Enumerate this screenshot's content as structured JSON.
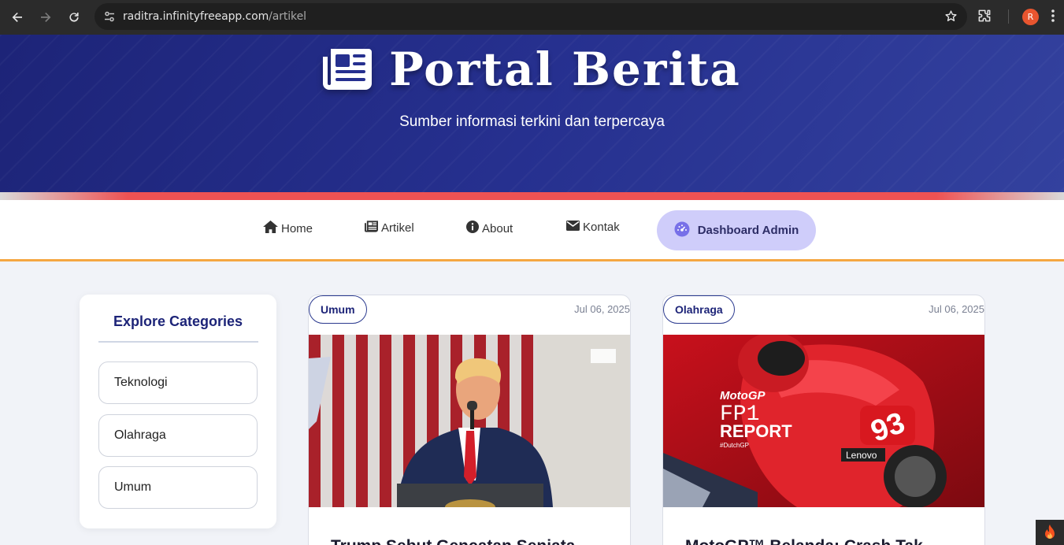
{
  "browser": {
    "url_host": "raditra.infinityfreeapp.com",
    "url_path": "/artikel",
    "profile_initial": "R"
  },
  "header": {
    "title": "Portal Berita",
    "tagline": "Sumber informasi terkini dan terpercaya",
    "icon": "newspaper-icon"
  },
  "nav": {
    "items": [
      {
        "label": "Home",
        "icon": "home-icon"
      },
      {
        "label": "Artikel",
        "icon": "newspaper-icon"
      },
      {
        "label": "About",
        "icon": "info-circle-icon"
      },
      {
        "label": "Kontak",
        "icon": "envelope-icon"
      }
    ],
    "dashboard_label": "Dashboard Admin",
    "dashboard_icon": "gauge-icon"
  },
  "sidebar": {
    "title": "Explore Categories",
    "categories": [
      "Teknologi",
      "Olahraga",
      "Umum"
    ]
  },
  "articles": [
    {
      "category": "Umum",
      "date": "Jul 06, 2025",
      "title": "Trump Sebut Gencatan Senjata"
    },
    {
      "category": "Olahraga",
      "date": "Jul 06, 2025",
      "title": "MotoGP™ Belanda: Crash Tak"
    }
  ],
  "colors": {
    "header_bg": "#26308f",
    "accent_strip": "#ee5253",
    "nav_border": "#f5a742",
    "dashboard_bg": "#cfcdfa",
    "brand_dark": "#1d2478"
  }
}
